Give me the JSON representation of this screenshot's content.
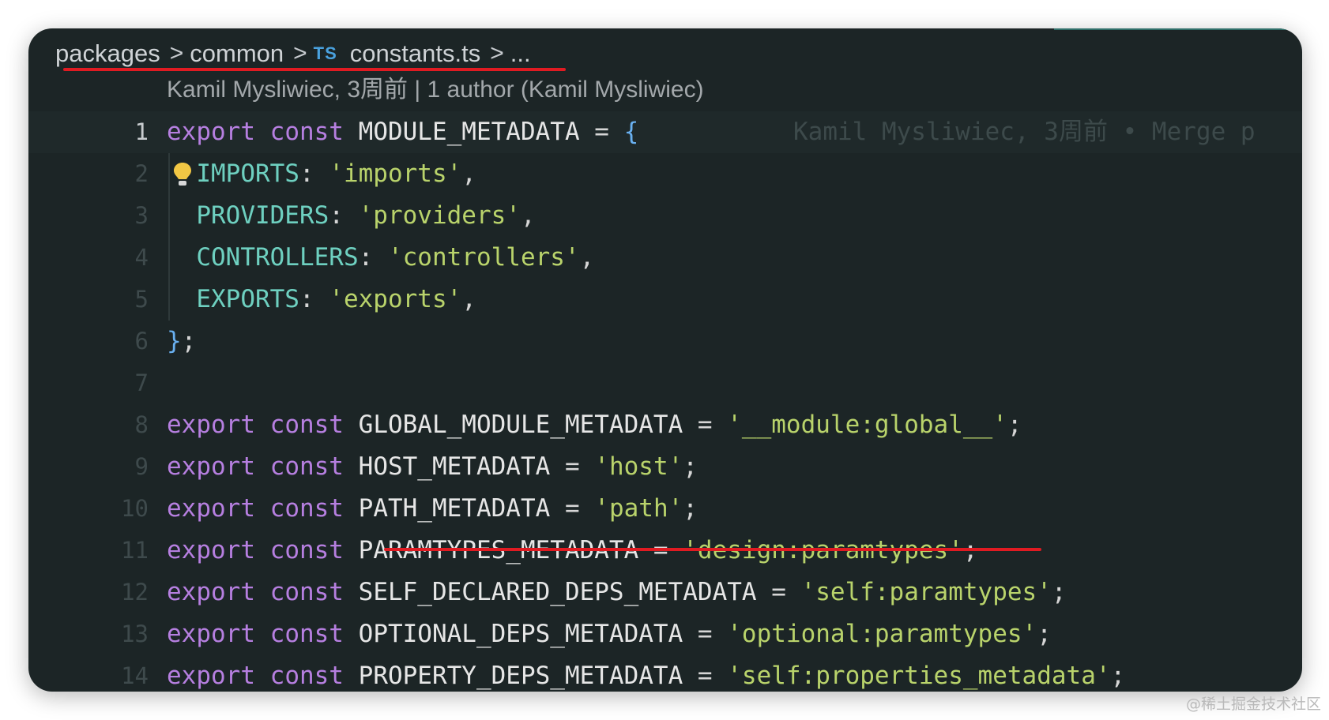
{
  "breadcrumb": {
    "items": [
      "packages",
      "common",
      "constants.ts",
      "..."
    ],
    "separator": ">",
    "file_icon": "TS"
  },
  "blame_header": "Kamil Mysliwiec, 3周前 | 1 author (Kamil Mysliwiec)",
  "inline_blame": "Kamil Mysliwiec, 3周前 • Merge p",
  "code_lines": [
    {
      "n": "1",
      "tokens": [
        [
          "kw",
          "export"
        ],
        [
          "punc",
          " "
        ],
        [
          "kw",
          "const"
        ],
        [
          "punc",
          " "
        ],
        [
          "id",
          "MODULE_METADATA"
        ],
        [
          "op",
          " = "
        ],
        [
          "brace",
          "{"
        ]
      ]
    },
    {
      "n": "2",
      "tokens": [
        [
          "punc",
          "  "
        ],
        [
          "prop",
          "IMPORTS"
        ],
        [
          "punc",
          ": "
        ],
        [
          "str",
          "'imports'"
        ],
        [
          "punc",
          ","
        ]
      ]
    },
    {
      "n": "3",
      "tokens": [
        [
          "punc",
          "  "
        ],
        [
          "prop",
          "PROVIDERS"
        ],
        [
          "punc",
          ": "
        ],
        [
          "str",
          "'providers'"
        ],
        [
          "punc",
          ","
        ]
      ]
    },
    {
      "n": "4",
      "tokens": [
        [
          "punc",
          "  "
        ],
        [
          "prop",
          "CONTROLLERS"
        ],
        [
          "punc",
          ": "
        ],
        [
          "str",
          "'controllers'"
        ],
        [
          "punc",
          ","
        ]
      ]
    },
    {
      "n": "5",
      "tokens": [
        [
          "punc",
          "  "
        ],
        [
          "prop",
          "EXPORTS"
        ],
        [
          "punc",
          ": "
        ],
        [
          "str",
          "'exports'"
        ],
        [
          "punc",
          ","
        ]
      ]
    },
    {
      "n": "6",
      "tokens": [
        [
          "brace",
          "}"
        ],
        [
          "punc",
          ";"
        ]
      ]
    },
    {
      "n": "7",
      "tokens": []
    },
    {
      "n": "8",
      "tokens": [
        [
          "kw",
          "export"
        ],
        [
          "punc",
          " "
        ],
        [
          "kw",
          "const"
        ],
        [
          "punc",
          " "
        ],
        [
          "id",
          "GLOBAL_MODULE_METADATA"
        ],
        [
          "op",
          " = "
        ],
        [
          "str",
          "'__module:global__'"
        ],
        [
          "punc",
          ";"
        ]
      ]
    },
    {
      "n": "9",
      "tokens": [
        [
          "kw",
          "export"
        ],
        [
          "punc",
          " "
        ],
        [
          "kw",
          "const"
        ],
        [
          "punc",
          " "
        ],
        [
          "id",
          "HOST_METADATA"
        ],
        [
          "op",
          " = "
        ],
        [
          "str",
          "'host'"
        ],
        [
          "punc",
          ";"
        ]
      ]
    },
    {
      "n": "10",
      "tokens": [
        [
          "kw",
          "export"
        ],
        [
          "punc",
          " "
        ],
        [
          "kw",
          "const"
        ],
        [
          "punc",
          " "
        ],
        [
          "id",
          "PATH_METADATA"
        ],
        [
          "op",
          " = "
        ],
        [
          "str",
          "'path'"
        ],
        [
          "punc",
          ";"
        ]
      ]
    },
    {
      "n": "11",
      "tokens": [
        [
          "kw",
          "export"
        ],
        [
          "punc",
          " "
        ],
        [
          "kw",
          "const"
        ],
        [
          "punc",
          " "
        ],
        [
          "id",
          "PARAMTYPES_METADATA"
        ],
        [
          "op",
          " = "
        ],
        [
          "str",
          "'design:paramtypes'"
        ],
        [
          "punc",
          ";"
        ]
      ]
    },
    {
      "n": "12",
      "tokens": [
        [
          "kw",
          "export"
        ],
        [
          "punc",
          " "
        ],
        [
          "kw",
          "const"
        ],
        [
          "punc",
          " "
        ],
        [
          "id",
          "SELF_DECLARED_DEPS_METADATA"
        ],
        [
          "op",
          " = "
        ],
        [
          "str",
          "'self:paramtypes'"
        ],
        [
          "punc",
          ";"
        ]
      ]
    },
    {
      "n": "13",
      "tokens": [
        [
          "kw",
          "export"
        ],
        [
          "punc",
          " "
        ],
        [
          "kw",
          "const"
        ],
        [
          "punc",
          " "
        ],
        [
          "id",
          "OPTIONAL_DEPS_METADATA"
        ],
        [
          "op",
          " = "
        ],
        [
          "str",
          "'optional:paramtypes'"
        ],
        [
          "punc",
          ";"
        ]
      ]
    },
    {
      "n": "14",
      "tokens": [
        [
          "kw",
          "export"
        ],
        [
          "punc",
          " "
        ],
        [
          "kw",
          "const"
        ],
        [
          "punc",
          " "
        ],
        [
          "id",
          "PROPERTY_DEPS_METADATA"
        ],
        [
          "op",
          " = "
        ],
        [
          "str",
          "'self:properties_metadata'"
        ],
        [
          "punc",
          ";"
        ]
      ]
    }
  ],
  "current_line": "1",
  "colors": {
    "background": "#1c2526",
    "keyword": "#b67fe0",
    "string": "#b9d36b",
    "property": "#6ed0c0",
    "annotation": "#e01b22"
  },
  "watermark": "@稀土掘金技术社区"
}
